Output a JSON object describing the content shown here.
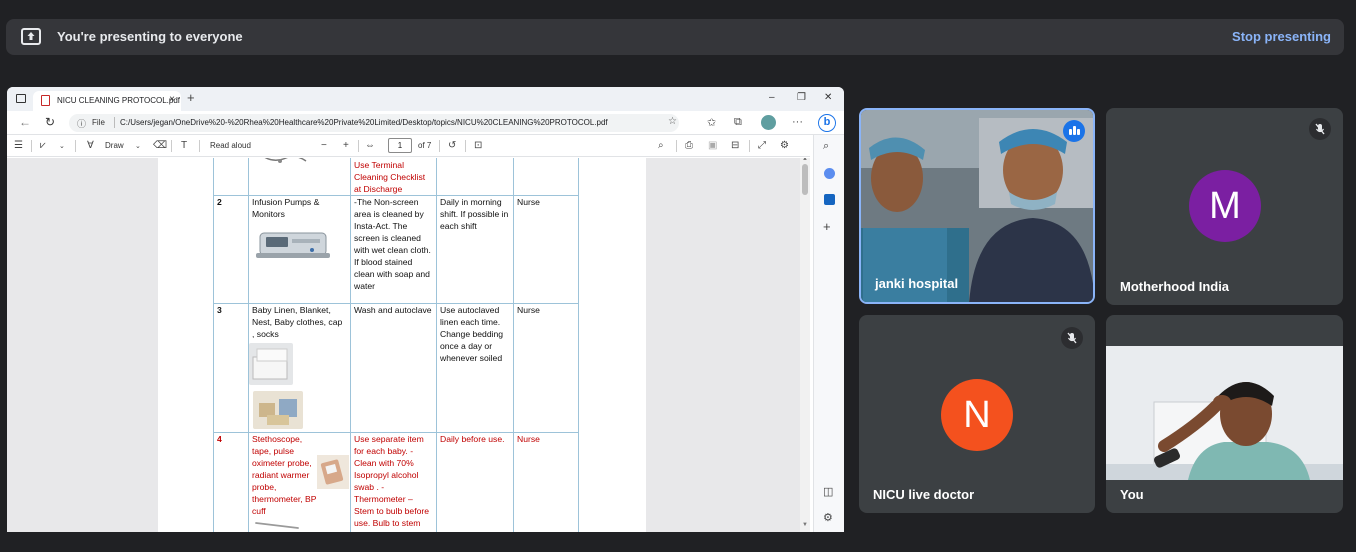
{
  "presenting_bar": {
    "message": "You're presenting to everyone",
    "stop_label": "Stop presenting",
    "icon": "present-to-all-icon"
  },
  "browser": {
    "tab_title": "NICU CLEANING PROTOCOL.pdf",
    "tab_close": "×",
    "new_tab": "+",
    "minimize": "–",
    "restore": "❐",
    "close": "✕",
    "url_info": "ⓘ",
    "url_scheme": "File",
    "url": "C:/Users/jegan/OneDrive%20-%20Rhea%20Healthcare%20Private%20Limited/Desktop/topics/NICU%20CLEANING%20PROTOCOL.pdf",
    "bing": "b"
  },
  "pdf_toolbar": {
    "draw_label": "Draw",
    "read_aloud_label": "Read aloud",
    "zoom_out": "−",
    "zoom_in": "+",
    "page_current": "1",
    "page_total": "of 7"
  },
  "protocol_rows": [
    {
      "no": "",
      "item": "",
      "method": "Use Terminal Cleaning Checklist at Discharge",
      "frequency": "",
      "responsible": "",
      "red": true
    },
    {
      "no": "2",
      "item": "Infusion Pumps & Monitors",
      "method": "-The Non-screen area is cleaned by Insta-Act. The screen is cleaned with wet clean cloth. If blood stained clean with soap and water",
      "frequency": "Daily in morning shift. If possible in each shift",
      "responsible": "Nurse",
      "red": false
    },
    {
      "no": "3",
      "item": "Baby Linen, Blanket, Nest, Baby clothes, cap , socks",
      "method": "Wash and autoclave",
      "frequency": "Use autoclaved linen each time. Change bedding once a day or whenever soiled",
      "responsible": "Nurse",
      "red": false
    },
    {
      "no": "4",
      "item": "Stethoscope, tape, pulse oximeter probe, radiant warmer probe, thermometer, BP cuff",
      "method": "Use separate item for each baby. -Clean with 70% Isopropyl alcohol swab . -Thermometer – Stem to bulb before use. Bulb to stem after use",
      "frequency": "Daily before use.",
      "responsible": "Nurse",
      "red": true
    }
  ],
  "participants": [
    {
      "name": "janki hospital",
      "state": "speaking",
      "video": true
    },
    {
      "name": "Motherhood India",
      "initial": "M",
      "avatar_color": "#7b1fa2",
      "muted": true
    },
    {
      "name": "NICU live doctor",
      "initial": "N",
      "avatar_color": "#f4511e",
      "muted": true
    },
    {
      "name": "You",
      "video": true
    }
  ]
}
